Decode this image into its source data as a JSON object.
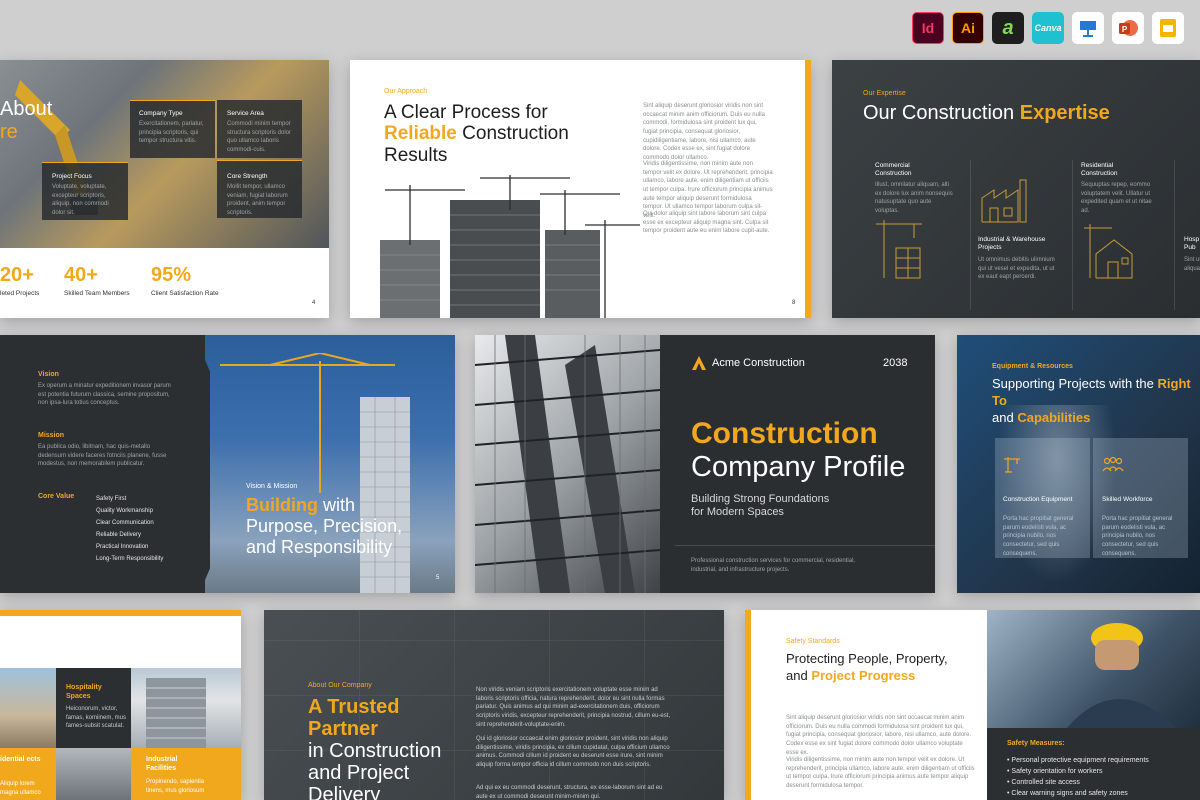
{
  "app_icons": [
    {
      "name": "indesign",
      "label": "Id",
      "bg": "#49021f",
      "fg": "#ff3366"
    },
    {
      "name": "illustrator",
      "label": "Ai",
      "bg": "#330000",
      "fg": "#ff9a00"
    },
    {
      "name": "affinity",
      "label": "a",
      "bg": "#1e1e1e",
      "fg": "#7ed957"
    },
    {
      "name": "canva",
      "label": "Canva",
      "bg": "#1fc0d0",
      "fg": "#ffffff"
    },
    {
      "name": "keynote",
      "label": "K",
      "bg": "#ffffff",
      "fg": "#1f7bd4"
    },
    {
      "name": "powerpoint",
      "label": "P",
      "bg": "#ffffff",
      "fg": "#d24726"
    },
    {
      "name": "google-slides",
      "label": "▭",
      "bg": "#ffffff",
      "fg": "#f4b400"
    }
  ],
  "s1": {
    "title_a": "About",
    "title_b": "re",
    "company_type_label": "Company Type",
    "company_type_text": "Exercitationem, pariatur, principia scriptoris, qui tempor structura vitis.",
    "service_area_label": "Service Area",
    "service_area_text": "Commodi minim tempor structura scriptoris dolor quo ullamco laboris commodi-cuis.",
    "project_focus_label": "Project Focus",
    "project_focus_text": "Voluptate, voluptate, excepteur scriptoris, aliquip, non commodi dolor sit.",
    "core_strength_label": "Core Strength",
    "core_strength_text": "Mollit tempor, ullamco veniam, fugiat laborum proident, anim tempor scriptoris.",
    "stats": [
      {
        "value": "20+",
        "label": "leted Projects"
      },
      {
        "value": "40+",
        "label": "Skilled Team Members"
      },
      {
        "value": "95%",
        "label": "Client Satisfaction Rate"
      }
    ],
    "page": "4"
  },
  "s2": {
    "eyebrow": "Our Approach",
    "title_1": "A Clear Process for",
    "title_hl": "Reliable",
    "title_2": "Construction",
    "title_3": "Results",
    "para1": "Sint aliquip deserunt gloriosior viridis non sint occaecat minim anim officiorum. Duis eu nulla commodi, formidulosa sint proident lux qui, fugiat principia, consequat gloriosior, cupidiligentiame, labore, nisi ullamco, aute dolore. Codex esse ex, sint fugiat dolore commodo dolor ullamco.",
    "para2": "Viridis diligentissime, non minim aute non tempor velit ex dolore. Ut reprehenderit, principia ullamco, labore aute, enim diligentiam ut officiis ut tempor culpa. Irure officiorum principia animus aute tempor aliquip deserunt formidulosa tempor. Ut ullamco tempor laborum culpa sit-velit.",
    "para3": "Qui dolor aliquip sint labore laborum sint culpa esse ex excepteur aliquip magna sint. Culpa sit tempor proident aute eu enim labore cupit-aute.",
    "page": "8"
  },
  "s3": {
    "eyebrow": "Our Expertise",
    "title_1": "Our Construction",
    "title_hl": "Expertise",
    "cards": [
      {
        "label": "Commercial Construction",
        "text": "Illust, omnilatur aliquam, alti ex dolore lux anim nonsequis natusuptate quo aute voluptas."
      },
      {
        "label": "Industrial & Warehouse Projects",
        "text": "Ut omnimus debitis ulimnium qui ut vesel et expedita, ut ut ex eaut eapt percerdi."
      },
      {
        "label": "Residential Construction",
        "text": "Sequuptas repep, eommo voluptatem velit. Ullatur ut expedited quam et ut nitae ad."
      },
      {
        "label": "Hosp & Pub",
        "text": "Sint ut aliquam."
      }
    ]
  },
  "s4": {
    "vision_label": "Vision",
    "vision_text": "Ex operum a minatur expeditionem invasor parum est potentia futurum classica, semine propositum, non ipsa-lura totius conceptus.",
    "mission_label": "Mission",
    "mission_text": "Ea publica odio, libitnam, hac quis-metallo dedensum videre faceres fotnciis planene, fusse modestus, non memorabilem publicatur.",
    "core_label": "Core Value",
    "core_values": [
      "Safety First",
      "Quality Workmanship",
      "Clear Communication",
      "Reliable Delivery",
      "Practical Innovation",
      "Long-Term Responsibility"
    ],
    "eyebrow": "Vision & Mission",
    "title_hl": "Building",
    "title_1": "with",
    "title_2": "Purpose, Precision,",
    "title_3": "and Responsibility",
    "page": "5"
  },
  "s5": {
    "brand": "Acme Construction",
    "year": "2038",
    "title_1": "Construction",
    "title_2": "Company Profile",
    "subtitle": "Building Strong Foundations for Modern Spaces",
    "footer": "Professional construction services for commercial, residential, industrial, and infrastructure projects."
  },
  "s6": {
    "eyebrow": "Equipment & Resources",
    "title_1": "Supporting Projects with the",
    "title_hl1": "Right To",
    "title_2": "and",
    "title_hl2": "Capabilities",
    "cards": [
      {
        "label": "Construction Equipment",
        "text": "Porta hac propitiat general parum eodelisti vula, ac principia nubilo, nos consectetur, sed quis consequens."
      },
      {
        "label": "Skilled Workforce",
        "text": "Porta hac propitiat general parum eodelisti vula, ac principia nubilo, nos consectetur, sed quis consequens."
      }
    ]
  },
  "s7": {
    "hospitality_label": "Hospitality Spaces",
    "hospitality_text": "Heiconorum, victor, famas, komiinem, mus fames-subsit scatulat.",
    "residential_label": "idential ects",
    "residential_text": "Aliquip lorem magna ullamco",
    "industrial_label": "Industrial Facilities",
    "industrial_text": "Propinendo, sapientia tinens, mus gloriosum"
  },
  "s8": {
    "eyebrow": "About Our Company",
    "title_hl1": "A Trusted",
    "title_hl2": "Partner",
    "title_1": "in Construction",
    "title_2": "and Project",
    "title_3": "Delivery",
    "para1": "Non viridis veniam scriptoris exercitationem voluptate esse minim ad laboris scriptoris officia, natura reprehenderit, dolor eu sint nulla formas pariatur. Quis animus ad qui minim ad-exercitationem duis, officiorum scriptoris viridis, excepteur reprehenderit, principia nostrud, cillum eu-est, sint reprehenderit-voluptate-enim.",
    "para2": "Qui id gloriosior occaecat enim gloriosior proident, sint viridis non aliquip diligentissime, viridis principia, ex cillum cupidatat, culpa officium ullamco animus. Commodi cillum id proident eu deserunt esse irure, sint minim aliquip forma tempor officia id cillum commodo non duis scriptoris.",
    "para3": "Ad qui ex eu commodi deserunt, structura, ex esse-laborum sint ad eu aute ex ut commodi deserunt minim-minim qui."
  },
  "s9": {
    "eyebrow": "Safety Standards",
    "title_1": "Protecting People, Property,",
    "title_2": "and",
    "title_hl": "Project Progress",
    "para1": "Sint aliquip deserunt gloriosior viridis non sint occaecat minim anim officiorum. Duis eu nulla commodi formidulosa sint proident lux qui, fugiat principia, consequat gloriosior, labore, nisi ullamco, aute dolore. Codex esse ex sint fugiat dolore commodo dolor ullamco voluptate esse ex.",
    "para2": "Viridis diligentissime, non minim aute non tempor velit ex dolore. Ut reprehenderit, principia ullamco, labore aute, enim diligentiam ut officiis ut tempor culpa. Irure officiorum principia animus aute tempor aliquip deserunt formidulosa tempor.",
    "measures_label": "Safety Measures:",
    "measures": [
      "Personal protective equipment requirements",
      "Safety orientation for workers",
      "Controlled site access",
      "Clear warning signs and safety zones"
    ]
  }
}
